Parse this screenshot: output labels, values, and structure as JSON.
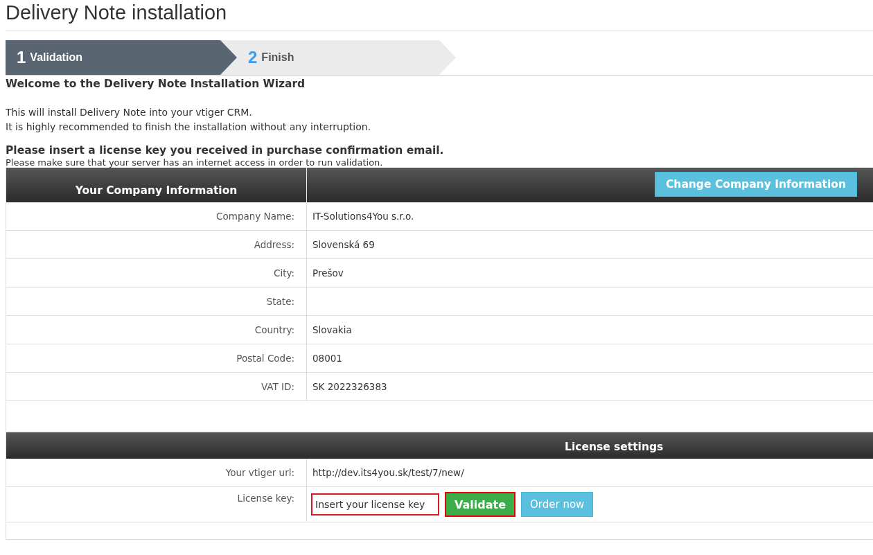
{
  "page_title": "Delivery Note installation",
  "steps": [
    {
      "number": "1",
      "label": "Validation",
      "selected": true
    },
    {
      "number": "2",
      "label": "Finish",
      "selected": false
    }
  ],
  "welcome_heading": "Welcome to the Delivery Note Installation Wizard",
  "intro_lines": [
    "This will install Delivery Note into your vtiger CRM.",
    "It is highly recommended to finish the installation without any interruption."
  ],
  "license_heading": "Please insert a license key you received in purchase confirmation email.",
  "license_note": "Please make sure that your server has an internet access in order to run validation.",
  "company": {
    "heading": "Your Company Information",
    "button": "Change Company Information",
    "rows": [
      {
        "label": "Company Name:",
        "value": "IT-Solutions4You s.r.o."
      },
      {
        "label": "Address:",
        "value": "Slovenská 69"
      },
      {
        "label": "City:",
        "value": "Prešov"
      },
      {
        "label": "State:"
      },
      {
        "label": "Country:",
        "value": "Slovakia"
      },
      {
        "label": "Postal Code:",
        "value": "08001"
      },
      {
        "label": "VAT ID:",
        "value": "SK 2022326383"
      }
    ]
  },
  "license": {
    "heading": "License settings",
    "url_label": "Your vtiger url:",
    "url": "http://dev.its4you.sk/test/7/new/",
    "key_label": "License key:",
    "key_placeholder": "Insert your license key",
    "validate_button": "Validate",
    "order_button": "Order now"
  }
}
